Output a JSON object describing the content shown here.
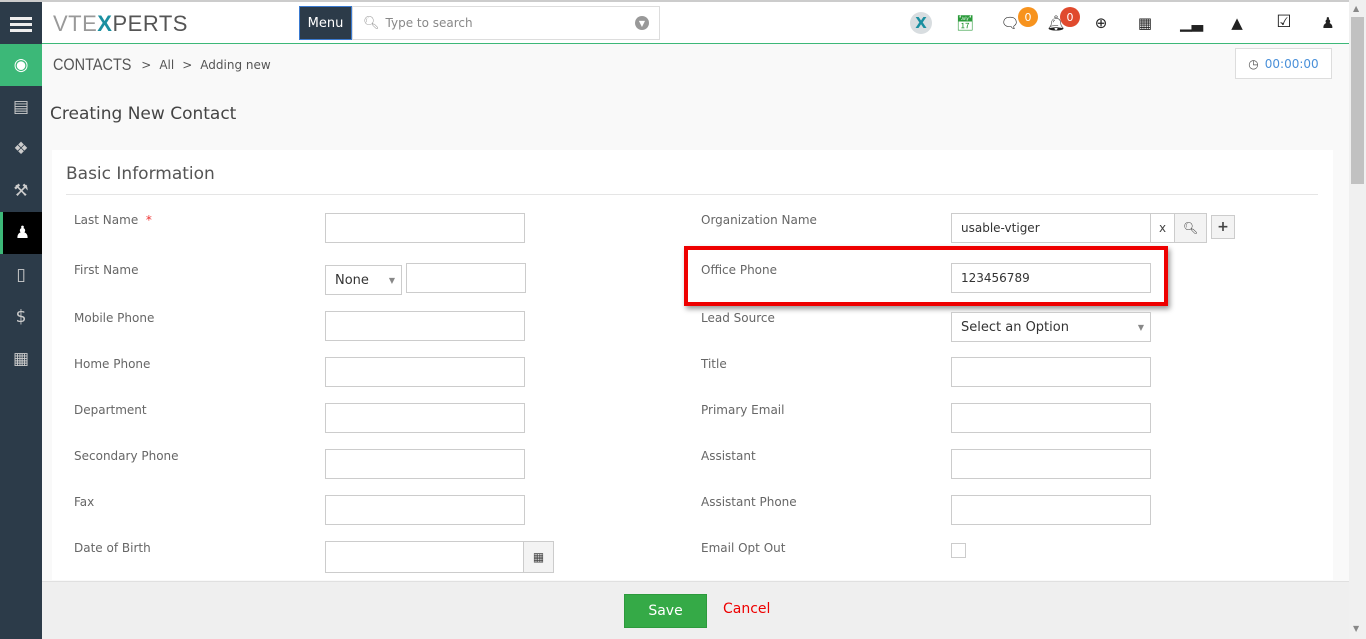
{
  "topbar": {
    "logo": {
      "part1": "VTE",
      "part2": "X",
      "part3": "PERTS"
    },
    "menu_label": "Menu",
    "search_placeholder": "Type to search",
    "icons": [
      "vtexperts-x-icon",
      "calendar-check-icon",
      "chat-icon",
      "bell-icon",
      "plus-circle-icon",
      "calendar-icon",
      "bar-chart-icon",
      "area-chart-icon",
      "checkbox-icon",
      "user-icon"
    ],
    "chat_badge": "0",
    "bell_badge": "0",
    "colors": {
      "chat_badge": "#f7931e",
      "bell_badge": "#e04a2e",
      "accent": "#3cb878",
      "nav": "#2c3b49"
    }
  },
  "sidebar": {
    "items": [
      "home-icon",
      "contacts-card-icon",
      "products-icon",
      "services-icon",
      "contacts-icon",
      "mobile-chat-icon",
      "money-bag-icon",
      "organizations-icon"
    ]
  },
  "breadcrumb": {
    "module": "CONTACTS",
    "sep": ">",
    "list": "All",
    "action": "Adding new"
  },
  "timer": "00:00:00",
  "page_title": "Creating New Contact",
  "section_title": "Basic Information",
  "form": {
    "left": [
      {
        "label": "Last Name",
        "required": "*",
        "value": ""
      },
      {
        "label": "First Name",
        "salutation": "None",
        "value": ""
      },
      {
        "label": "Mobile Phone",
        "value": ""
      },
      {
        "label": "Home Phone",
        "value": ""
      },
      {
        "label": "Department",
        "value": ""
      },
      {
        "label": "Secondary Phone",
        "value": ""
      },
      {
        "label": "Fax",
        "value": ""
      },
      {
        "label": "Date of Birth",
        "value": ""
      }
    ],
    "right": [
      {
        "label": "Organization Name",
        "value": "usable-vtiger",
        "clear": "x"
      },
      {
        "label": "Office Phone",
        "value": "123456789"
      },
      {
        "label": "Lead Source",
        "value": "Select an Option"
      },
      {
        "label": "Title",
        "value": ""
      },
      {
        "label": "Primary Email",
        "value": ""
      },
      {
        "label": "Assistant",
        "value": ""
      },
      {
        "label": "Assistant Phone",
        "value": ""
      },
      {
        "label": "Email Opt Out",
        "checked": false
      }
    ]
  },
  "footer": {
    "save": "Save",
    "cancel": "Cancel"
  }
}
